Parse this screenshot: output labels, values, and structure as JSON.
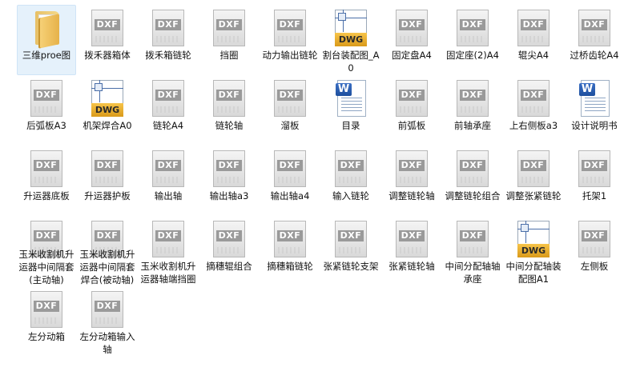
{
  "files": [
    {
      "label": "三维proe图",
      "type": "folder",
      "selected": true
    },
    {
      "label": "拨禾器箱体",
      "type": "dxf"
    },
    {
      "label": "拨禾箱链轮",
      "type": "dxf"
    },
    {
      "label": "挡圈",
      "type": "dxf"
    },
    {
      "label": "动力输出链轮",
      "type": "dxf"
    },
    {
      "label": "割台装配图_A0",
      "type": "dwg"
    },
    {
      "label": "固定盘A4",
      "type": "dxf"
    },
    {
      "label": "固定座(2)A4",
      "type": "dxf"
    },
    {
      "label": "辊尖A4",
      "type": "dxf"
    },
    {
      "label": "过桥齿轮A4",
      "type": "dxf"
    },
    {
      "label": "后弧板A3",
      "type": "dxf"
    },
    {
      "label": "机架焊合A0",
      "type": "dwg"
    },
    {
      "label": "链轮A4",
      "type": "dxf"
    },
    {
      "label": "链轮轴",
      "type": "dxf"
    },
    {
      "label": "溜板",
      "type": "dxf"
    },
    {
      "label": "目录",
      "type": "doc"
    },
    {
      "label": "前弧板",
      "type": "dxf"
    },
    {
      "label": "前轴承座",
      "type": "dxf"
    },
    {
      "label": "上右侧板a3",
      "type": "dxf"
    },
    {
      "label": "设计说明书",
      "type": "doc"
    },
    {
      "label": "升运器底板",
      "type": "dxf"
    },
    {
      "label": "升运器护板",
      "type": "dxf"
    },
    {
      "label": "输出轴",
      "type": "dxf"
    },
    {
      "label": "输出轴a3",
      "type": "dxf"
    },
    {
      "label": "输出轴a4",
      "type": "dxf"
    },
    {
      "label": "输入链轮",
      "type": "dxf"
    },
    {
      "label": "调整链轮轴",
      "type": "dxf"
    },
    {
      "label": "调整链轮组合",
      "type": "dxf"
    },
    {
      "label": "调整张紧链轮",
      "type": "dxf"
    },
    {
      "label": "托架1",
      "type": "dxf"
    },
    {
      "label": "玉米收割机升运器中间隔套(主动轴)",
      "type": "dxf"
    },
    {
      "label": "玉米收割机升运器中间隔套焊合(被动轴)",
      "type": "dxf"
    },
    {
      "label": "玉米收割机升运器轴端挡圈",
      "type": "dxf"
    },
    {
      "label": "摘穗辊组合",
      "type": "dxf"
    },
    {
      "label": "摘穗箱链轮",
      "type": "dxf"
    },
    {
      "label": "张紧链轮支架",
      "type": "dxf"
    },
    {
      "label": "张紧链轮轴",
      "type": "dxf"
    },
    {
      "label": "中间分配轴轴承座",
      "type": "dxf"
    },
    {
      "label": "中间分配轴装配图A1",
      "type": "dwg"
    },
    {
      "label": "左侧板",
      "type": "dxf"
    },
    {
      "label": "左分动箱",
      "type": "dxf"
    },
    {
      "label": "左分动箱输入轴",
      "type": "dxf"
    }
  ],
  "icon_text": {
    "dxf": "DXF",
    "dwg": "DWG",
    "doc": "W"
  },
  "icon_names": {
    "dxf": "dxf-file-icon",
    "dwg": "dwg-file-icon",
    "doc": "word-doc-icon",
    "folder": "folder-icon"
  }
}
